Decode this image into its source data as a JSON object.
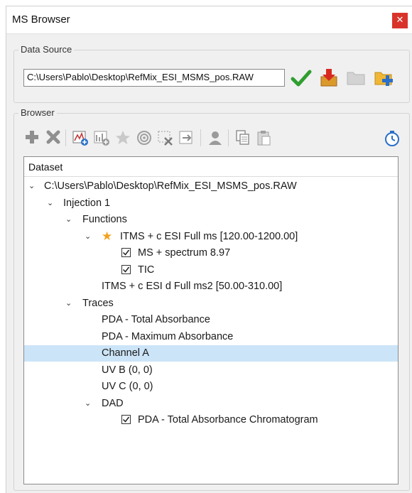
{
  "window": {
    "title": "MS Browser",
    "close_symbol": "✕"
  },
  "data_source": {
    "label": "Data Source",
    "path": "C:\\Users\\Pablo\\Desktop\\RefMix_ESI_MSMS_pos.RAW",
    "actions": [
      "check-icon",
      "import-icon",
      "folder-icon",
      "add-folder-icon"
    ]
  },
  "browser": {
    "label": "Browser",
    "toolbar_icons": [
      "add-icon",
      "remove-icon",
      "spectrum-add-icon",
      "chromatogram-add-icon",
      "star-icon",
      "target-icon",
      "delete-selection-icon",
      "export-icon",
      "user-icon",
      "copy-icon",
      "paste-icon",
      "timer-icon"
    ],
    "tree": {
      "header": "Dataset",
      "nodes": [
        {
          "label": "C:\\Users\\Pablo\\Desktop\\RefMix_ESI_MSMS_pos.RAW",
          "expander": "⌄"
        },
        {
          "label": "Injection 1",
          "expander": "⌄"
        },
        {
          "label": "Functions",
          "expander": "⌄"
        },
        {
          "label": "ITMS + c ESI Full ms [120.00-1200.00]",
          "expander": "⌄",
          "starred": true
        },
        {
          "label": "MS + spectrum 8.97",
          "checked": true
        },
        {
          "label": "TIC",
          "checked": true
        },
        {
          "label": "ITMS + c ESI d Full ms2 [50.00-310.00]"
        },
        {
          "label": "Traces",
          "expander": "⌄"
        },
        {
          "label": "PDA - Total Absorbance"
        },
        {
          "label": "PDA - Maximum Absorbance"
        },
        {
          "label": "Channel A",
          "selected": true
        },
        {
          "label": "UV B (0, 0)"
        },
        {
          "label": "UV C (0, 0)"
        },
        {
          "label": "DAD",
          "expander": "⌄"
        },
        {
          "label": "PDA - Total Absorbance Chromatogram",
          "checked": true
        }
      ]
    }
  },
  "colors": {
    "selection": "#cce4f7",
    "close_button": "#d9342b",
    "star": "#f0a21f",
    "check_green": "#2f9e2f"
  }
}
